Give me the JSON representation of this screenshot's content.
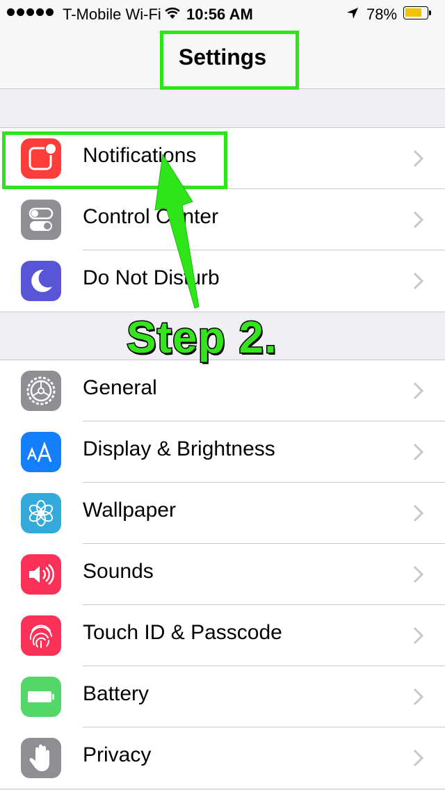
{
  "status_bar": {
    "carrier": "T-Mobile Wi-Fi",
    "time": "10:56 AM",
    "battery_percent": "78%",
    "battery_level": 0.78,
    "signal_icon": "signal-dots-icon",
    "wifi_icon": "wifi-icon",
    "location_icon": "location-arrow-icon"
  },
  "header": {
    "title": "Settings"
  },
  "groups": [
    {
      "items": [
        {
          "label": "Notifications",
          "icon": "notifications-icon",
          "icon_color": "#fc3d39"
        },
        {
          "label": "Control Center",
          "icon": "control-center-icon",
          "icon_color": "#8e8e93"
        },
        {
          "label": "Do Not Disturb",
          "icon": "moon-icon",
          "icon_color": "#5856d6"
        }
      ]
    },
    {
      "items": [
        {
          "label": "General",
          "icon": "gear-icon",
          "icon_color": "#8e8e93"
        },
        {
          "label": "Display & Brightness",
          "icon": "display-aa-icon",
          "icon_color": "#147efb"
        },
        {
          "label": "Wallpaper",
          "icon": "flower-icon",
          "icon_color": "#34aadc"
        },
        {
          "label": "Sounds",
          "icon": "speaker-icon",
          "icon_color": "#fc3158"
        },
        {
          "label": "Touch ID & Passcode",
          "icon": "fingerprint-icon",
          "icon_color": "#fc3158"
        },
        {
          "label": "Battery",
          "icon": "battery-icon",
          "icon_color": "#53d769"
        },
        {
          "label": "Privacy",
          "icon": "hand-icon",
          "icon_color": "#8e8e93"
        }
      ]
    }
  ],
  "annotation": {
    "step_label": "Step 2.",
    "color": "#2ee51a"
  }
}
